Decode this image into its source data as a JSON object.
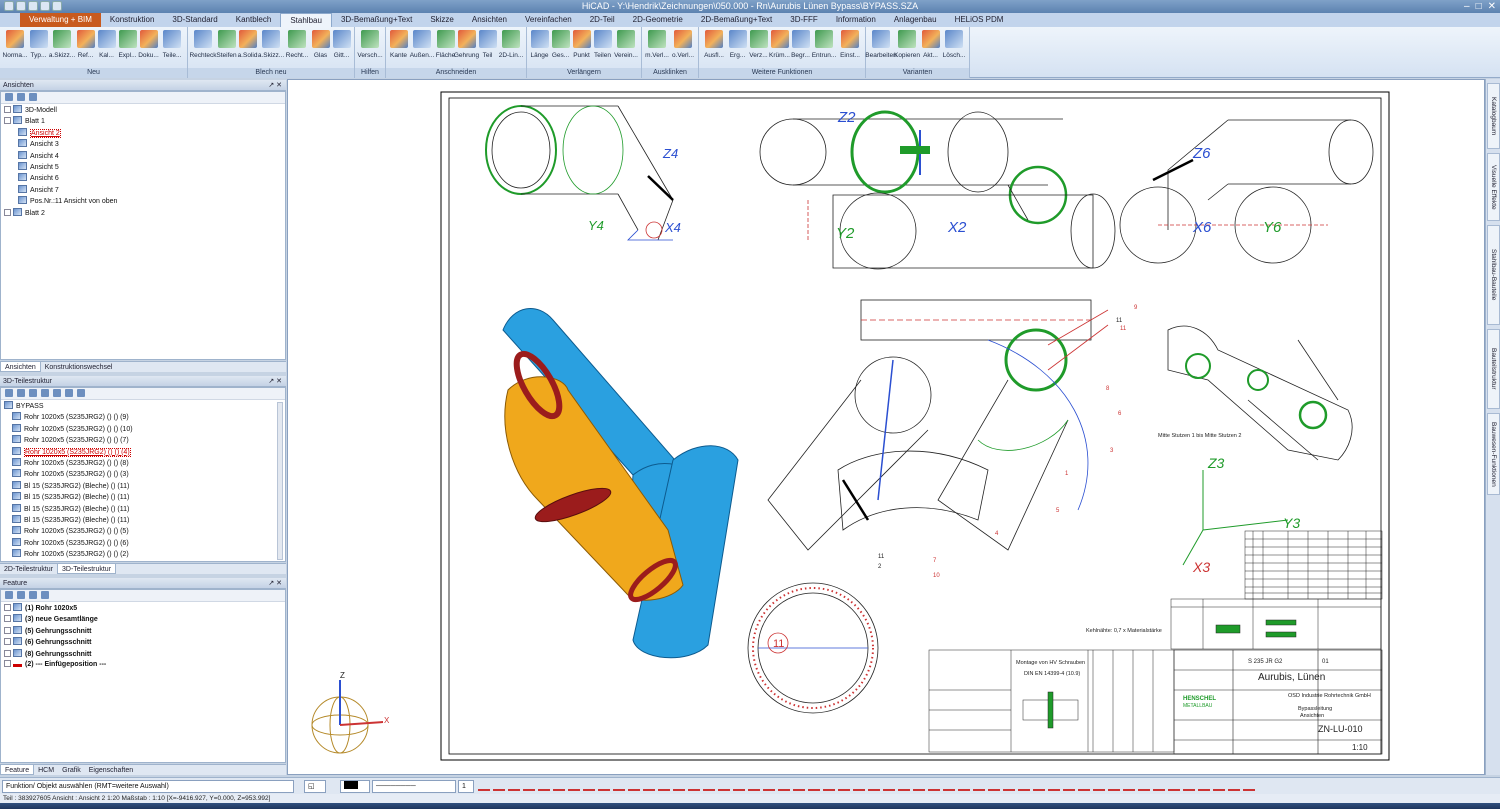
{
  "window": {
    "title": "HiCAD - Y:\\Hendrik\\Zeichnungen\\050.000 - Rn\\Aurubis Lünen Bypass\\BYPASS.SZA",
    "controls": [
      "minimize-icon",
      "restore-icon",
      "close-icon"
    ]
  },
  "tabs": [
    "Verwaltung + BIM",
    "Konstruktion",
    "3D-Standard",
    "Kantblech",
    "Stahlbau",
    "3D-Bemaßung+Text",
    "Skizze",
    "Ansichten",
    "Vereinfachen",
    "2D-Teil",
    "2D-Geometrie",
    "2D-Bemaßung+Text",
    "3D-FFF",
    "Information",
    "Anlagenbau",
    "HELiOS PDM"
  ],
  "active_tab": "Stahlbau",
  "ribbon": {
    "groups": [
      {
        "label": "Neu",
        "buttons": [
          "Norma...",
          "Typ...",
          "a.Skizz...",
          "Ref...",
          "Kal...",
          "Expl...",
          "Doku...",
          "Teile..."
        ]
      },
      {
        "label": "Blech neu",
        "buttons": [
          "Rechteck",
          "Steifen",
          "a.Solid",
          "a.Skizz...",
          "Recht...",
          "Glas",
          "Gitt..."
        ]
      },
      {
        "label": "Hilfen",
        "buttons": [
          "Versch..."
        ]
      },
      {
        "label": "Anschneiden",
        "buttons": [
          "Kante",
          "Außen...",
          "Fläche",
          "Gehrung",
          "Teil",
          "2D-Lin..."
        ]
      },
      {
        "label": "Verlängern",
        "buttons": [
          "Länge",
          "Ges...",
          "Punkt",
          "Teilen",
          "Verein..."
        ]
      },
      {
        "label": "Ausklinken",
        "buttons": [
          "m.Verl...",
          "o.Verl..."
        ]
      },
      {
        "label": "Weitere Funktionen",
        "buttons": [
          "Ausfl...",
          "Erg...",
          "Verz...",
          "Krüm...",
          "Begr...",
          "Entrun...",
          "Einst..."
        ]
      },
      {
        "label": "Varianten",
        "buttons": [
          "Bearbeiten",
          "Kopieren",
          "Akt...",
          "Lösch..."
        ]
      }
    ]
  },
  "views_panel": {
    "title": "Ansichten",
    "items": [
      {
        "label": "3D-Modell",
        "level": 0
      },
      {
        "label": "Blatt 1",
        "level": 0
      },
      {
        "label": "Ansicht 2",
        "level": 1,
        "selected": true
      },
      {
        "label": "Ansicht 3",
        "level": 1
      },
      {
        "label": "Ansicht 4",
        "level": 1
      },
      {
        "label": "Ansicht 5",
        "level": 1
      },
      {
        "label": "Ansicht 6",
        "level": 1
      },
      {
        "label": "Ansicht 7",
        "level": 1
      },
      {
        "label": "Pos.Nr.:11 Ansicht von oben",
        "level": 1
      },
      {
        "label": "Blatt 2",
        "level": 0
      }
    ],
    "tabs": [
      "Ansichten",
      "Konstruktionswechsel"
    ]
  },
  "parts_panel": {
    "title": "3D-Teilestruktur",
    "root": "BYPASS",
    "items": [
      "Rohr 1020x5 (S235JRG2) () () (9)",
      "Rohr 1020x5 (S235JRG2) () () (10)",
      "Rohr 1020x5 (S235JRG2) () () (7)",
      "Rohr 1020x5 (S235JRG2) () () (4)",
      "Rohr 1020x5 (S235JRG2) () () (8)",
      "Rohr 1020x5 (S235JRG2) () () (3)",
      "Bl 15 (S235JRG2) (Bleche) () (11)",
      "Bl 15 (S235JRG2) (Bleche) () (11)",
      "Bl 15 (S235JRG2) (Bleche) () (11)",
      "Bl 15 (S235JRG2) (Bleche) () (11)",
      "Rohr 1020x5 (S235JRG2) () () (5)",
      "Rohr 1020x5 (S235JRG2) () () (6)",
      "Rohr 1020x5 (S235JRG2) () () (2)",
      "Bl 5 mm (S235JRG2) () () (1)"
    ],
    "selected_index": 3,
    "tabs": [
      "2D-Teilestruktur",
      "3D-Teilestruktur"
    ]
  },
  "feature_panel": {
    "title": "Feature",
    "items": [
      "(1) Rohr 1020x5",
      "(3) neue Gesamtlänge",
      "(5) Gehrungsschnitt",
      "(6) Gehrungsschnitt",
      "(8) Gehrungsschnitt",
      "(2) --- Einfügeposition ---"
    ],
    "tabs": [
      "Feature",
      "HCM",
      "Grafik",
      "Eigenschaften"
    ]
  },
  "right_tabs": [
    "Katalogbaum",
    "Visuelle Effekte",
    "Stahlbau-Bauteile",
    "Bauteilstruktur",
    "Bauwesen-Funktionen"
  ],
  "drawing": {
    "view_labels": [
      "Z4",
      "Y4",
      "X4",
      "Z2",
      "X2",
      "Y2",
      "Z6",
      "Y6",
      "X6",
      "Z3",
      "Y3",
      "X3"
    ],
    "position_numbers": [
      "9",
      "11",
      "11",
      "8",
      "3",
      "1",
      "7",
      "10",
      "4",
      "11",
      "5",
      "6",
      "2"
    ],
    "detail_number": "11",
    "iso_caption": "Mitte Stutzen 1 bis Mitte Stutzen 2",
    "weld_note": "Kehlnähte: 0,7 x Materialstärke",
    "bolt_title": "Montage von HV Schrauben",
    "bolt_norm": "DIN EN 14399-4 (10.9)",
    "title_block": {
      "client": "Aurubis, Lünen",
      "company": "OSD Industrie Rohrtechnik GmbH",
      "part_name": "Bypassleitung",
      "subtitle": "Ansichten",
      "drawing_no": "ZN-LU-010",
      "material": "S 235 JR G2",
      "sheet": "01",
      "scale": "1:10",
      "logo_line1": "HENSCHEL",
      "logo_line2": "METALLBAU"
    }
  },
  "axis_labels": [
    "Z",
    "X",
    "Y"
  ],
  "command_line": "Funktion/ Objekt auswählen (RMT=weitere Auswahl)",
  "line_width_value": "1",
  "status": "Teil : 383927605   Ansicht : Ansicht 2 1:20   Maßstab : 1:10   [X=-9416.927, Y=0.000, Z=953.992]",
  "colors": {
    "ribbon_active": "#eef4fb",
    "pipe_blue": "#2aa0e0",
    "pipe_orange": "#f0a81c",
    "ring_red": "#9b1c1c",
    "green_weld": "#1f9b2a"
  }
}
